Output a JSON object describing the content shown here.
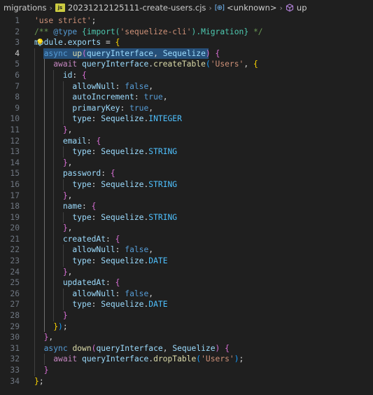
{
  "breadcrumb": {
    "folder": "migrations",
    "file_icon": "js",
    "file": "20231212125111-create-users.cjs",
    "symbol_icon": "[⊕]",
    "symbol": "<unknown>",
    "method": "up"
  },
  "editor": {
    "current_line": 4,
    "line_numbers": [
      "1",
      "2",
      "3",
      "4",
      "5",
      "6",
      "7",
      "8",
      "9",
      "10",
      "11",
      "12",
      "13",
      "14",
      "15",
      "16",
      "17",
      "18",
      "19",
      "20",
      "21",
      "22",
      "23",
      "24",
      "25",
      "26",
      "27",
      "28",
      "29",
      "30",
      "31",
      "32",
      "33",
      "34"
    ],
    "lines": [
      "'use strict';",
      "/** @type {import('sequelize-cli').Migration} */",
      "module.exports = {",
      "  async up(queryInterface, Sequelize) {",
      "    await queryInterface.createTable('Users', {",
      "      id: {",
      "        allowNull: false,",
      "        autoIncrement: true,",
      "        primaryKey: true,",
      "        type: Sequelize.INTEGER",
      "      },",
      "      email: {",
      "        type: Sequelize.STRING",
      "      },",
      "      password: {",
      "        type: Sequelize.STRING",
      "      },",
      "      name: {",
      "        type: Sequelize.STRING",
      "      },",
      "      createdAt: {",
      "        allowNull: false,",
      "        type: Sequelize.DATE",
      "      },",
      "      updatedAt: {",
      "        allowNull: false,",
      "        type: Sequelize.DATE",
      "      }",
      "    });",
      "  },",
      "  async down(queryInterface, Sequelize) {",
      "    await queryInterface.dropTable('Users');",
      "  }",
      "};"
    ]
  },
  "colors": {
    "background": "#1f1f1f",
    "selection": "#264f78",
    "keyword": "#569cd6",
    "control": "#c586c0",
    "string": "#ce9178",
    "function": "#dcdcaa",
    "variable": "#9cdcfe",
    "comment": "#6a9955",
    "bracket_level1": "#ffd700",
    "bracket_level2": "#da70d6",
    "bracket_level3": "#179fff"
  },
  "icons": {
    "chevron": "chevron-right-icon",
    "file": "js-file-icon",
    "symbol": "symbol-variable-icon",
    "method": "symbol-method-icon",
    "bulb": "lightbulb-icon"
  }
}
